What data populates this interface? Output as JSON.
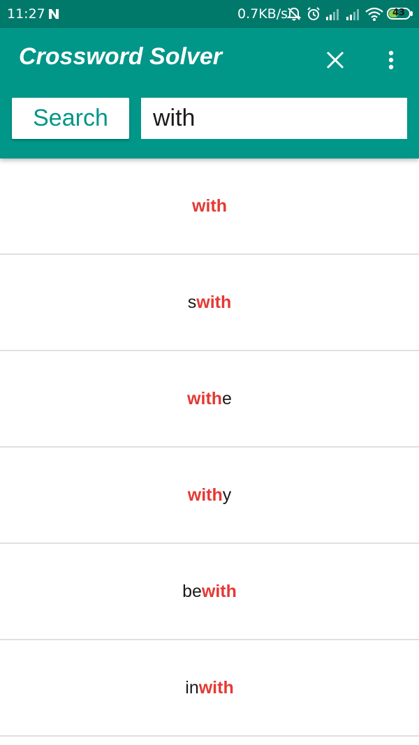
{
  "status_bar": {
    "time": "11:27",
    "net_speed": "0.7KB/s",
    "battery_level": "43",
    "icons": [
      "n-notification-icon",
      "mute-icon",
      "alarm-icon",
      "signal-icon",
      "signal-icon",
      "wifi-icon",
      "battery-icon"
    ]
  },
  "app_bar": {
    "title": "Crossword Solver",
    "search_button_label": "Search",
    "search_value": "with"
  },
  "results": [
    {
      "prefix": "",
      "match": "with",
      "suffix": ""
    },
    {
      "prefix": "s",
      "match": "with",
      "suffix": ""
    },
    {
      "prefix": "",
      "match": "with",
      "suffix": "e"
    },
    {
      "prefix": "",
      "match": "with",
      "suffix": "y"
    },
    {
      "prefix": "be",
      "match": "with",
      "suffix": ""
    },
    {
      "prefix": "in",
      "match": "with",
      "suffix": ""
    }
  ],
  "colors": {
    "status_bar": "#00796b",
    "app_bar": "#009688",
    "highlight": "#e53935",
    "divider": "#e0e0e0"
  }
}
